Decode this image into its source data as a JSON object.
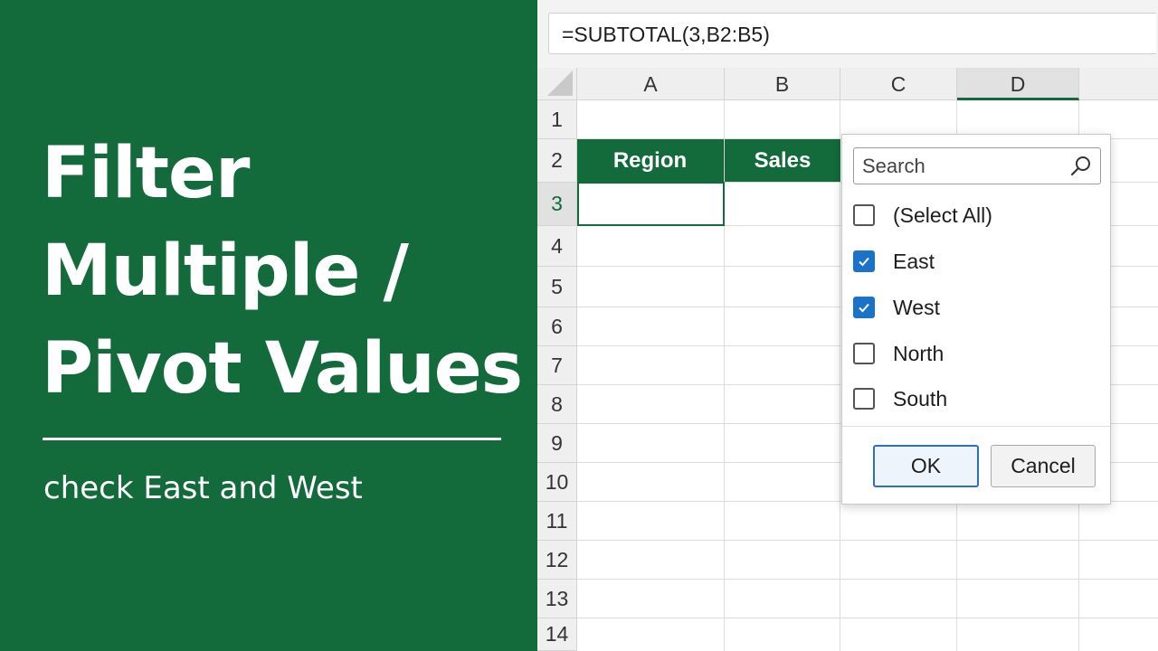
{
  "title": {
    "lines": [
      "Filter",
      "Multiple /",
      "Pivot Values"
    ],
    "subtitle": "check East and West"
  },
  "formula_bar": {
    "formula": "=SUBTOTAL(3,B2:B5)"
  },
  "columns": [
    "A",
    "B",
    "C",
    "D"
  ],
  "selected_column": "D",
  "rows": [
    "1",
    "2",
    "3",
    "4",
    "5",
    "6",
    "7",
    "8",
    "9",
    "10",
    "11",
    "12",
    "13",
    "14"
  ],
  "selected_row": "3",
  "table_headers": {
    "region": "Region",
    "sales": "Sales"
  },
  "filter_dropdown": {
    "search_placeholder": "Search",
    "items": [
      {
        "label": "(Select All)",
        "checked": false
      },
      {
        "label": "East",
        "checked": true
      },
      {
        "label": "West",
        "checked": true
      },
      {
        "label": "North",
        "checked": false
      },
      {
        "label": "South",
        "checked": false
      }
    ],
    "ok_label": "OK",
    "cancel_label": "Cancel"
  },
  "colors": {
    "brand_green": "#136a3b",
    "checkbox_blue": "#1a73c9"
  }
}
